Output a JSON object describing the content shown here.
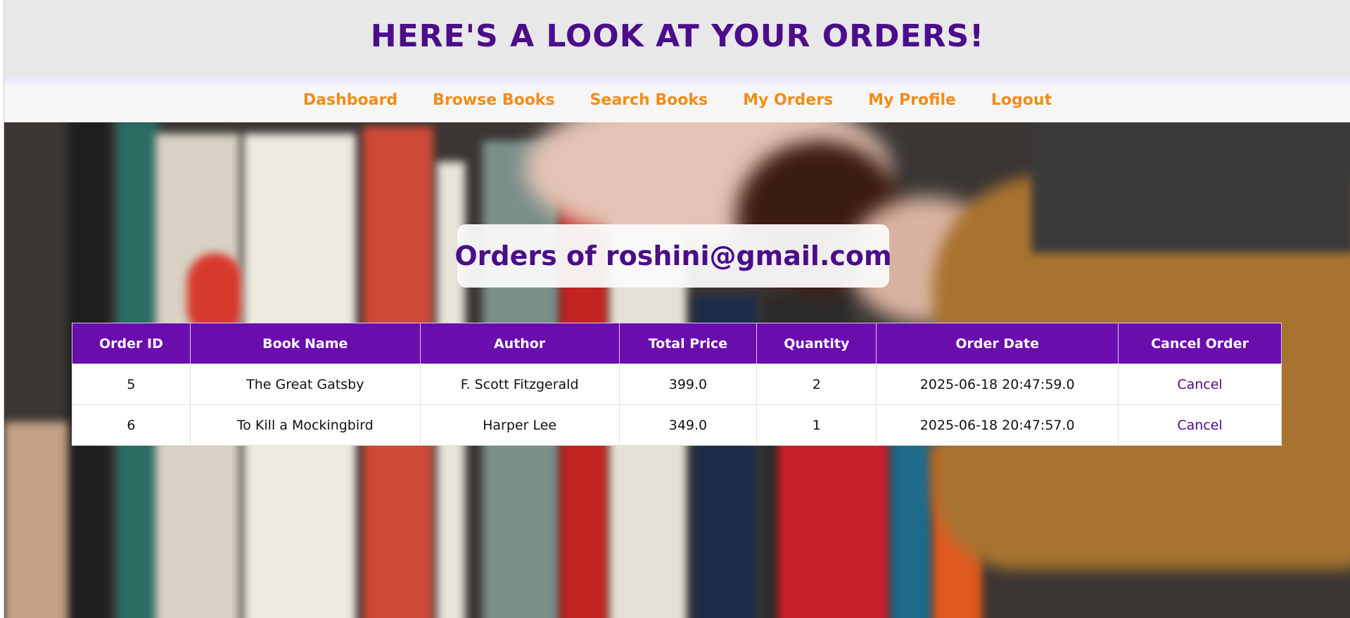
{
  "header": {
    "title": "HERE'S A LOOK AT YOUR ORDERS!"
  },
  "nav": {
    "items": [
      {
        "label": "Dashboard"
      },
      {
        "label": "Browse Books"
      },
      {
        "label": "Search Books"
      },
      {
        "label": "My Orders"
      },
      {
        "label": "My Profile"
      },
      {
        "label": "Logout"
      }
    ]
  },
  "main": {
    "title": "Orders of roshini@gmail.com",
    "table": {
      "columns": [
        "Order ID",
        "Book Name",
        "Author",
        "Total Price",
        "Quantity",
        "Order Date",
        "Cancel Order"
      ],
      "rows": [
        {
          "order_id": "5",
          "book_name": "The Great Gatsby",
          "author": "F. Scott Fitzgerald",
          "total_price": "399.0",
          "quantity": "2",
          "order_date": "2025-06-18 20:47:59.0",
          "cancel_label": "Cancel"
        },
        {
          "order_id": "6",
          "book_name": "To Kill a Mockingbird",
          "author": "Harper Lee",
          "total_price": "349.0",
          "quantity": "1",
          "order_date": "2025-06-18 20:47:57.0",
          "cancel_label": "Cancel"
        }
      ]
    }
  },
  "colors": {
    "brand_purple": "#4b0d8a",
    "table_header": "#6a0dad",
    "nav_orange": "#f28c17"
  },
  "background": {
    "icon": "bookshelf-photo"
  }
}
